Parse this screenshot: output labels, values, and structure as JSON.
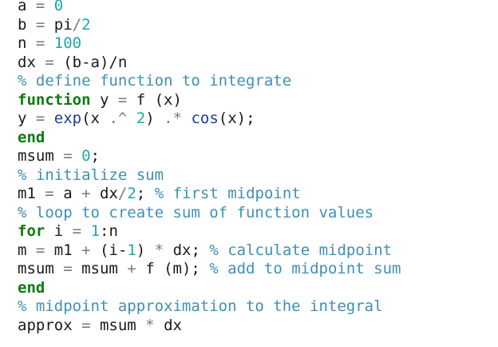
{
  "code": {
    "lines": [
      [
        {
          "t": "a",
          "c": "id"
        },
        {
          "t": " = ",
          "c": "op"
        },
        {
          "t": "0",
          "c": "num"
        }
      ],
      [
        {
          "t": "b",
          "c": "id"
        },
        {
          "t": " = ",
          "c": "op"
        },
        {
          "t": "pi",
          "c": "id"
        },
        {
          "t": "/",
          "c": "op"
        },
        {
          "t": "2",
          "c": "num"
        }
      ],
      [
        {
          "t": "n",
          "c": "id"
        },
        {
          "t": " = ",
          "c": "op"
        },
        {
          "t": "100",
          "c": "num"
        }
      ],
      [
        {
          "t": "dx",
          "c": "id"
        },
        {
          "t": " = ",
          "c": "op"
        },
        {
          "t": "(b-a)/n",
          "c": "id"
        }
      ],
      [
        {
          "t": "% define function to integrate",
          "c": "cmt"
        }
      ],
      [
        {
          "t": "function",
          "c": "kw"
        },
        {
          "t": " y ",
          "c": "id"
        },
        {
          "t": "=",
          "c": "op"
        },
        {
          "t": " f (x)",
          "c": "id"
        }
      ],
      [
        {
          "t": "y",
          "c": "id"
        },
        {
          "t": " = ",
          "c": "op"
        },
        {
          "t": "exp",
          "c": "fn"
        },
        {
          "t": "(x ",
          "c": "id"
        },
        {
          "t": ".^",
          "c": "op"
        },
        {
          "t": " ",
          "c": "id"
        },
        {
          "t": "2",
          "c": "num"
        },
        {
          "t": ") ",
          "c": "id"
        },
        {
          "t": ".*",
          "c": "op"
        },
        {
          "t": " ",
          "c": "id"
        },
        {
          "t": "cos",
          "c": "fn"
        },
        {
          "t": "(x);",
          "c": "id"
        }
      ],
      [
        {
          "t": "end",
          "c": "kw"
        }
      ],
      [
        {
          "t": "msum",
          "c": "id"
        },
        {
          "t": " = ",
          "c": "op"
        },
        {
          "t": "0",
          "c": "num"
        },
        {
          "t": ";",
          "c": "id"
        }
      ],
      [
        {
          "t": "% initialize sum",
          "c": "cmt"
        }
      ],
      [
        {
          "t": "m1",
          "c": "id"
        },
        {
          "t": " = ",
          "c": "op"
        },
        {
          "t": "a ",
          "c": "id"
        },
        {
          "t": "+",
          "c": "op"
        },
        {
          "t": " dx",
          "c": "id"
        },
        {
          "t": "/",
          "c": "op"
        },
        {
          "t": "2",
          "c": "num"
        },
        {
          "t": "; ",
          "c": "id"
        },
        {
          "t": "% first midpoint",
          "c": "cmt"
        }
      ],
      [
        {
          "t": "% loop to create sum of function values",
          "c": "cmt"
        }
      ],
      [
        {
          "t": "for",
          "c": "kw"
        },
        {
          "t": " i ",
          "c": "id"
        },
        {
          "t": "=",
          "c": "op"
        },
        {
          "t": " ",
          "c": "id"
        },
        {
          "t": "1",
          "c": "num"
        },
        {
          "t": ":n",
          "c": "id"
        }
      ],
      [
        {
          "t": "m",
          "c": "id"
        },
        {
          "t": " = ",
          "c": "op"
        },
        {
          "t": "m1 ",
          "c": "id"
        },
        {
          "t": "+",
          "c": "op"
        },
        {
          "t": " (i-",
          "c": "id"
        },
        {
          "t": "1",
          "c": "num"
        },
        {
          "t": ") ",
          "c": "id"
        },
        {
          "t": "*",
          "c": "op"
        },
        {
          "t": " dx; ",
          "c": "id"
        },
        {
          "t": "% calculate midpoint",
          "c": "cmt"
        }
      ],
      [
        {
          "t": "msum",
          "c": "id"
        },
        {
          "t": " = ",
          "c": "op"
        },
        {
          "t": "msum ",
          "c": "id"
        },
        {
          "t": "+",
          "c": "op"
        },
        {
          "t": " f (m); ",
          "c": "id"
        },
        {
          "t": "% add to midpoint sum",
          "c": "cmt"
        }
      ],
      [
        {
          "t": "end",
          "c": "kw"
        }
      ],
      [
        {
          "t": "% midpoint approximation to the integral",
          "c": "cmt"
        }
      ],
      [
        {
          "t": "approx",
          "c": "id"
        },
        {
          "t": " = ",
          "c": "op"
        },
        {
          "t": "msum ",
          "c": "id"
        },
        {
          "t": "*",
          "c": "op"
        },
        {
          "t": " dx",
          "c": "id"
        }
      ]
    ]
  },
  "colors": {
    "keyword": "#0e7a0d",
    "number": "#23a6a6",
    "comment": "#3f8fb5",
    "builtin_function": "#1f3a9e",
    "operator": "#7a7a7a",
    "identifier": "#1a1a1a",
    "background": "#ffffff"
  }
}
